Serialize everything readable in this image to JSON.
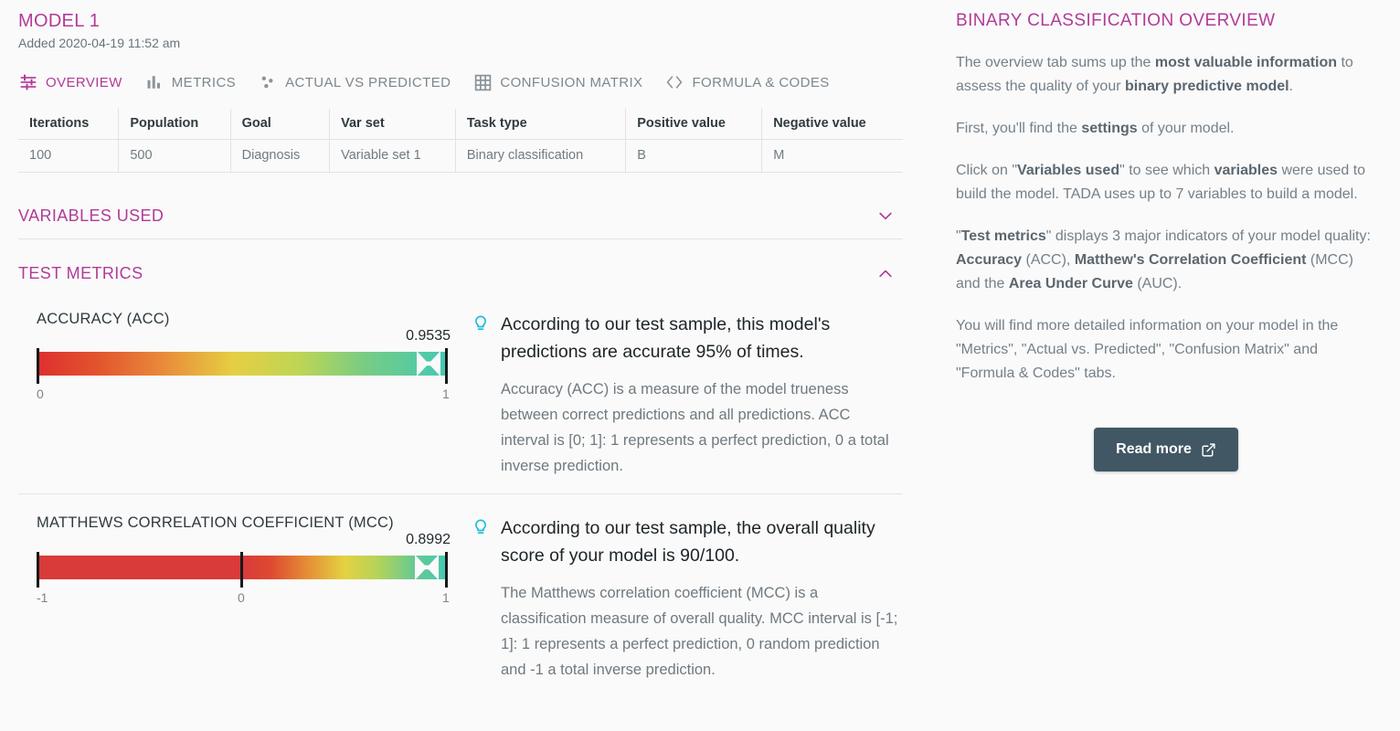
{
  "accent": "#b23b98",
  "model": {
    "title": "MODEL 1",
    "added": "Added 2020-04-19 11:52 am"
  },
  "tabs": [
    {
      "label": "OVERVIEW",
      "icon": "tune-icon",
      "active": true
    },
    {
      "label": "METRICS",
      "icon": "bar-chart-icon",
      "active": false
    },
    {
      "label": "ACTUAL VS PREDICTED",
      "icon": "scatter-plot-icon",
      "active": false
    },
    {
      "label": "CONFUSION MATRIX",
      "icon": "grid-table-icon",
      "active": false
    },
    {
      "label": "FORMULA & CODES",
      "icon": "code-brackets-icon",
      "active": false
    }
  ],
  "settings_table": {
    "headers": [
      "Iterations",
      "Population",
      "Goal",
      "Var set",
      "Task type",
      "Positive value",
      "Negative value"
    ],
    "rows": [
      [
        "100",
        "500",
        "Diagnosis",
        "Variable set 1",
        "Binary classification",
        "B",
        "M"
      ]
    ]
  },
  "sections": {
    "variables_used": {
      "title": "VARIABLES USED",
      "expanded": false,
      "chevron": "chevron-down-icon"
    },
    "test_metrics": {
      "title": "TEST METRICS",
      "expanded": true,
      "chevron": "chevron-up-icon"
    }
  },
  "chart_data": [
    {
      "type": "bar",
      "name": "accuracy-gauge",
      "title": "ACCURACY (ACC)",
      "value": 0.9535,
      "value_label": "0.9535",
      "xlim": [
        0,
        1
      ],
      "tick_labels": [
        "0",
        "1"
      ],
      "tick_values": [
        0,
        1
      ],
      "gradient_start": 0,
      "solid_segment": null,
      "colors": [
        "#e03131",
        "#e8622c",
        "#edb63c",
        "#e3d63f",
        "#a9d05e",
        "#5cc7a0",
        "#3fc9bc"
      ],
      "marker": "bowtie-marker"
    },
    {
      "type": "bar",
      "name": "mcc-gauge",
      "title": "MATTHEWS CORRELATION COEFFICIENT (MCC)",
      "value": 0.8992,
      "value_label": "0.8992",
      "xlim": [
        -1,
        1
      ],
      "tick_labels": [
        "-1",
        "0",
        "1"
      ],
      "tick_values": [
        -1,
        0,
        1
      ],
      "gradient_start": 0,
      "solid_segment": [
        -1,
        0
      ],
      "colors": [
        "#d93a3a",
        "#e0512f",
        "#e79b38",
        "#e3d63f",
        "#aad15c",
        "#5cc7a0",
        "#3fc9bc"
      ],
      "marker": "bowtie-marker"
    }
  ],
  "metrics": [
    {
      "name": "ACCURACY (ACC)",
      "value_label": "0.9535",
      "min_label": "0",
      "max_label": "1",
      "tip_icon": "lightbulb-icon",
      "tip_headline": "According to our test sample, this model's predictions are accurate 95% of times.",
      "tip_description": "Accuracy (ACC) is a measure of the model trueness between correct predictions and all predictions. ACC interval is [0; 1]: 1 represents a perfect prediction, 0 a total inverse prediction."
    },
    {
      "name": "MATTHEWS CORRELATION COEFFICIENT (MCC)",
      "value_label": "0.8992",
      "min_label": "-1",
      "mid_label": "0",
      "max_label": "1",
      "tip_icon": "lightbulb-icon",
      "tip_headline": "According to our test sample, the overall quality score of your model is 90/100.",
      "tip_description": "The Matthews correlation coefficient (MCC) is a classification measure of overall quality. MCC interval is [-1; 1]: 1 represents a perfect prediction, 0 random prediction and -1 a total inverse prediction."
    }
  ],
  "side_panel": {
    "title": "BINARY CLASSIFICATION OVERVIEW",
    "paragraphs": [
      "The overview tab sums up the <b>most valuable information</b> to assess the quality of your <b>binary predictive model</b>.",
      "First, you'll find the <b>settings</b> of your model.",
      "Click on \"<b>Variables used</b>\" to see which <b>variables</b> were used to build the model. TADA uses up to 7 variables to build a model.",
      "\"<b>Test metrics</b>\" displays 3 major indicators of your model quality: <b>Accuracy</b> (ACC), <b>Matthew's Correlation Coefficient</b> (MCC) and the <b>Area Under Curve</b> (AUC).",
      "You will find more detailed information on your model in the \"Metrics\", \"Actual vs. Predicted\", \"Confusion Matrix\" and \"Formula &amp; Codes\" tabs."
    ],
    "read_more_label": "Read more",
    "read_more_icon": "external-link-icon",
    "read_more_bg": "#415764"
  }
}
